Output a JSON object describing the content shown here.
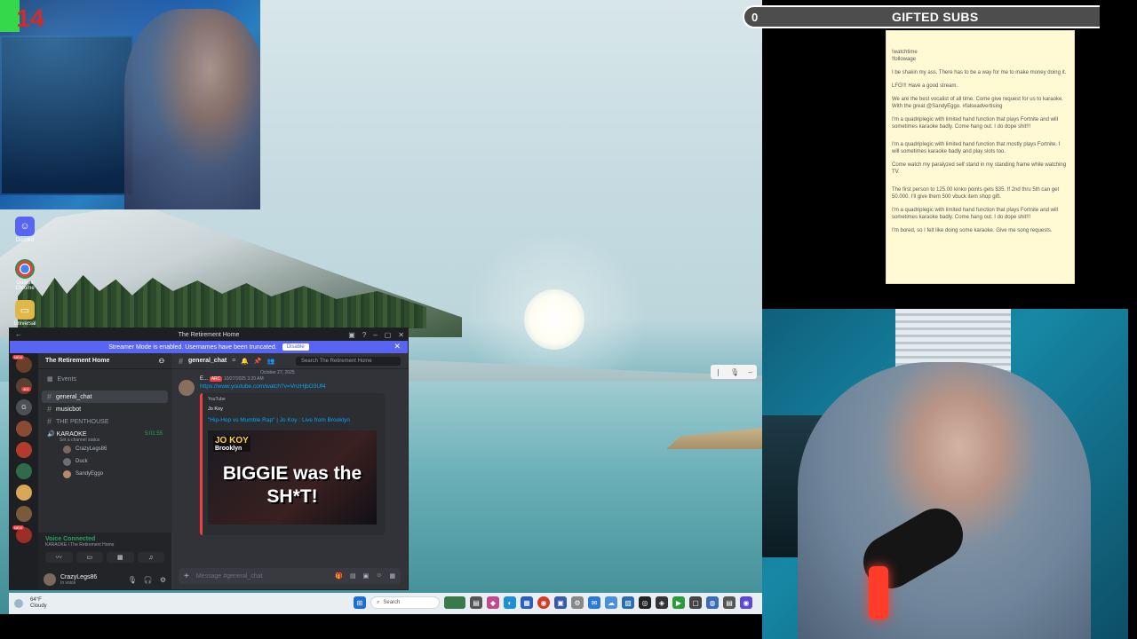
{
  "overlay": {
    "counter": "14",
    "gifted_subs": {
      "min": "0",
      "label": "GIFTED SUBS",
      "max": "200",
      "progress": 0.0
    }
  },
  "notes": [
    "!watchtime\n!followage",
    "I be shakin my ass. There has to be a way for me to make money doing it.",
    "LFG!!! Have a good stream.",
    "We are the best vocalist of all time.  Come give request for us to karaoke. With the great @SandyEggo. #falseadvertising",
    "I'm a quadriplegic with limited hand function that plays Fortnite and will sometimes karaoke badly. Come hang out. I do dope shit!!!",
    "I'm a quadriplegic with limited hand function that mostly plays Fortnite. I will sometimes karaoke badly and play slots too.",
    "Come watch my paralyzed self stand in my standing frame while watching TV.",
    "The first person to 125.00 kinko points gets $35. If 2nd thru 5th can get 50.000. I'll give them 500 vbuck item shop gift.",
    "I'm a quadriplegic with limited hand function that plays Fortnite and will sometimes karaoke badly. Come hang out. I do dope shit!!!",
    "I'm bored, so I felt like doing some karaoke. Give me song requests."
  ],
  "desktop_icons": [
    {
      "label": "Discord",
      "icon": "discord-icon",
      "color": "#5865f2"
    },
    {
      "label": "Google Chrome",
      "icon": "chrome-icon",
      "color": "#db4437"
    },
    {
      "label": "Universal",
      "icon": "folder-icon",
      "color": "#e0b84a"
    }
  ],
  "discord": {
    "window_title": "The Retirement Home",
    "banner": {
      "text": "Streamer Mode is enabled. Usernames have been truncated.",
      "button": "Disable"
    },
    "guild_name": "The Retirement Home",
    "channels": {
      "events": "Events",
      "general": "general_chat",
      "musicbot": "musicbot",
      "penthouse": "THE PENTHOUSE",
      "karaoke": "KARAOKE",
      "karaoke_timer": "5:01:55",
      "karaoke_status": "Set a channel status",
      "voice_users": [
        "CrazyLegs86",
        "Duck",
        "SandyEggo"
      ]
    },
    "voice": {
      "title": "Voice Connected",
      "sub": "KARAOKE / The Retirement Home"
    },
    "user": {
      "name": "CrazyLegs86",
      "status": "In voice"
    },
    "chat": {
      "channel": "general_chat",
      "search_placeholder": "Search The Retirement Home",
      "date_divider": "October 27, 2025",
      "message": {
        "author": "E...",
        "tag": "ARC",
        "time": "10/27/2025 3:20 AM",
        "link": "https://www.youtube.com/watch?v=VnzHjbO3Uf4",
        "embed": {
          "provider": "YouTube",
          "author": "Jo Koy",
          "title": "\"Hip-Hop vs Mumble Rap\" | Jo Koy : Live from Brooklyn",
          "thumb_brand": "JO KOY",
          "thumb_sub": "Brooklyn",
          "thumb_caption": "BIGGIE was the SH*T!"
        }
      },
      "compose_placeholder": "Message #general_chat"
    },
    "server_badges": {
      "new1": "NEW",
      "new2": "NEW",
      "count": "401"
    }
  },
  "taskbar": {
    "weather_temp": "64°F",
    "weather_cond": "Cloudy",
    "search_label": "Search"
  }
}
